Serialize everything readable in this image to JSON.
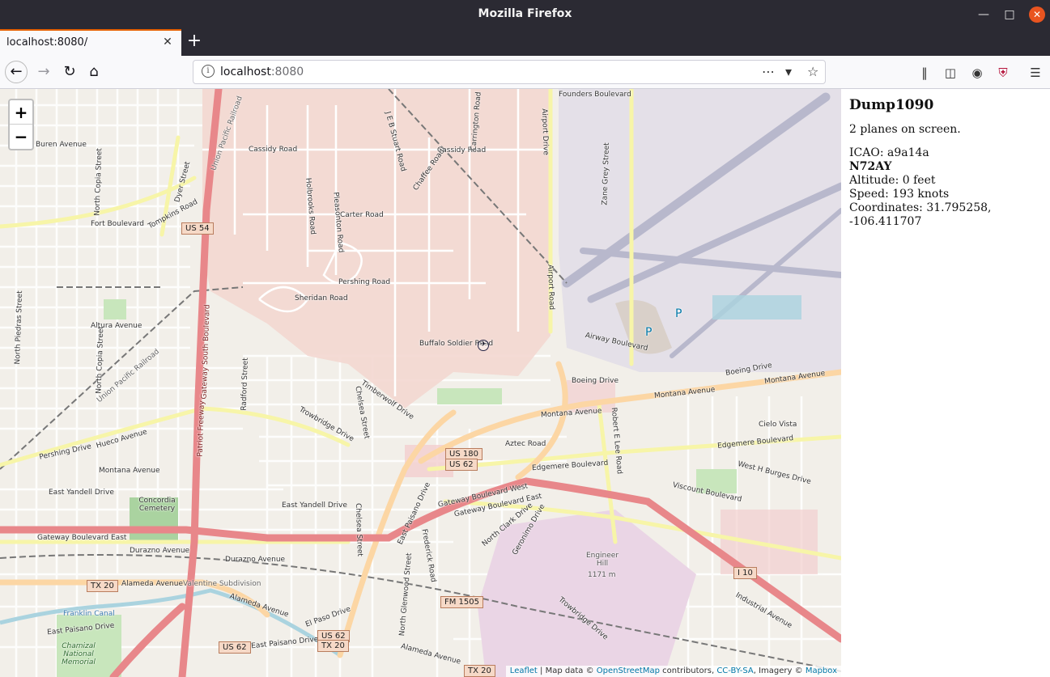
{
  "window": {
    "title": "Mozilla Firefox"
  },
  "tabs": [
    {
      "label": "localhost:8080/"
    }
  ],
  "urlbar": {
    "host": "localhost",
    "port": ":8080"
  },
  "map": {
    "zoom_in": "+",
    "zoom_out": "−",
    "labels": {
      "founders_blvd": "Founders Boulevard",
      "buren": "Buren Avenue",
      "cassidy1": "Cassidy Road",
      "cassidy2": "Cassidy Road",
      "fort_blvd": "Fort Boulevard",
      "tompkins": "Tompkins Road",
      "dyer": "Dyer Street",
      "carter": "Carter Road",
      "pershing_road": "Pershing Road",
      "sheridan_road": "Sheridan Road",
      "altura": "Altura Avenue",
      "buffalo": "Buffalo Soldier Road",
      "airway": "Airway Boulevard",
      "boeing1": "Boeing Drive",
      "boeing2": "Boeing Drive",
      "montana1": "Montana Avenue",
      "montana2": "Montana Avenue",
      "montana3": "Montana Avenue",
      "montana4": "Montana Avenue",
      "cielo": "Cielo Vista",
      "edgemere1": "Edgemere Boulevard",
      "edgemere2": "Edgemere Boulevard",
      "aztec": "Aztec Road",
      "hueco": "Hueco Avenue",
      "pershing_drive": "Pershing Drive",
      "trowbridge1": "Trowbridge Drive",
      "trowbridge2": "Trowbridge Drive",
      "timberwolf": "Timberwolf Drive",
      "east_yandell1": "East Yandell Drive",
      "east_yandell2": "East Yandell Drive",
      "concordia": "Concordia Cemetery",
      "gateway_east": "Gateway Boulevard East",
      "gateway_west": "Gateway Boulevard West",
      "gateway_east2": "Gateway Boulevard East",
      "durazno1": "Durazno Avenue",
      "durazno2": "Durazno Avenue",
      "alameda1": "Alameda Avenue",
      "alameda2": "Alameda Avenue",
      "alameda3": "Alameda Avenue",
      "valentine": "Valentine Subdivision",
      "franklin": "Franklin Canal",
      "east_paisano1": "East Paisano Drive",
      "east_paisano2": "East Paisano Drive",
      "east_paisano3": "East Paisano Drive",
      "el_paso": "El Paso Drive",
      "chamizal": "Chamizal National Memorial",
      "engineer": "Engineer Hill",
      "engineer_elev": "1171 m",
      "viscount": "Viscount Boulevard",
      "burges": "West H Burges Drive",
      "industrial": "Industrial Avenue",
      "north_clark": "North Clark Drive",
      "geronimo": "Geronimo Drive",
      "frederick": "Frederick Road",
      "robert_e_lee": "Robert E Lee Road",
      "north_glenwood": "North Glenwood Street",
      "north_piedras": "North Piedras Street",
      "north_copia1": "North Copia Street",
      "north_copia2": "North Copia Street",
      "radford": "Radford Street",
      "chelsea1": "Chelsea Street",
      "chelsea2": "Chelsea Street",
      "patriot": "Patriot Freeway",
      "gateway_south": "Gateway South Boulevard",
      "union_pacific1": "Union Pacific Railroad",
      "union_pacific2": "Union Pacific Railroad",
      "airport_drive": "Airport Drive",
      "airport_road": "Airport Road",
      "zane_grey": "Zane Grey Street",
      "pleasonton": "Pleasonton Road",
      "holbrooks": "Holbrooks Road",
      "je_b_stuart": "J E B Stuart Road",
      "chaffee": "Chaffee Road",
      "carrington": "Carrington Road",
      "parking1": "P",
      "parking2": "P"
    },
    "shields": {
      "us54": "US 54",
      "us180": "US 180",
      "us62": "US 62",
      "us62b": "US 62",
      "us62c": "US 62",
      "tx20a": "TX 20",
      "tx20b": "TX 20",
      "tx20c": "TX 20",
      "i10": "I 10",
      "fm1505": "FM 1505"
    },
    "attribution": {
      "leaflet": "Leaflet",
      "sep": " | Map data © ",
      "osm": "OpenStreetMap",
      "contrib": " contributors, ",
      "ccbysa": "CC-BY-SA",
      "imagery": ", Imagery © ",
      "mapbox": "Mapbox"
    }
  },
  "panel": {
    "title": "Dump1090",
    "planes_on_screen": "2 planes on screen.",
    "icao": "ICAO: a9a14a",
    "callsign": "N72AY",
    "altitude": "Altitude: 0 feet",
    "speed": "Speed: 193 knots",
    "coordinates": "Coordinates: 31.795258,",
    "coordinates_2": "-106.411707"
  },
  "colors": {
    "fort_bliss": "#f3d7d0",
    "airport": "#e4e0e8",
    "runway": "#b8b8cc",
    "freeway": "#e8878a",
    "primary": "#fcd6a4",
    "secondary": "#f7f5a8",
    "park": "#c8e6bc",
    "cemetery": "#aad3a0"
  }
}
